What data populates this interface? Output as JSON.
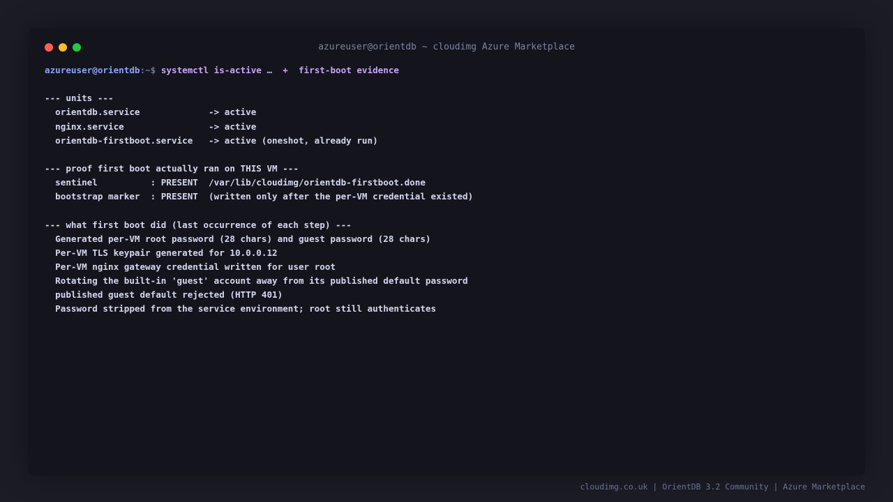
{
  "window": {
    "title": "azureuser@orientdb ~ cloudimg Azure Marketplace"
  },
  "prompt": {
    "user_host": "azureuser@orientdb",
    "path": ":~$",
    "command": " systemctl is-active …  +  first-boot evidence"
  },
  "output_lines": [
    "",
    "--- units ---",
    "  orientdb.service             -> active",
    "  nginx.service                -> active",
    "  orientdb-firstboot.service   -> active (oneshot, already run)",
    "",
    "--- proof first boot actually ran on THIS VM ---",
    "  sentinel          : PRESENT  /var/lib/cloudimg/orientdb-firstboot.done",
    "  bootstrap marker  : PRESENT  (written only after the per-VM credential existed)",
    "",
    "--- what first boot did (last occurrence of each step) ---",
    "  Generated per-VM root password (28 chars) and guest password (28 chars)",
    "  Per-VM TLS keypair generated for 10.0.0.12",
    "  Per-VM nginx gateway credential written for user root",
    "  Rotating the built-in 'guest' account away from its published default password",
    "  published guest default rejected (HTTP 401)",
    "  Password stripped from the service environment; root still authenticates"
  ],
  "footer": {
    "text": "cloudimg.co.uk | OrientDB 3.2 Community | Azure Marketplace"
  },
  "colors": {
    "background": "#1c1c25",
    "terminal_bg": "#14141c",
    "text": "#d4d8f0",
    "prompt_user": "#8aa4f8",
    "prompt_command": "#c8a6f5",
    "dot_red": "#ff5f57",
    "dot_yellow": "#febc2e",
    "dot_green": "#28c840"
  }
}
